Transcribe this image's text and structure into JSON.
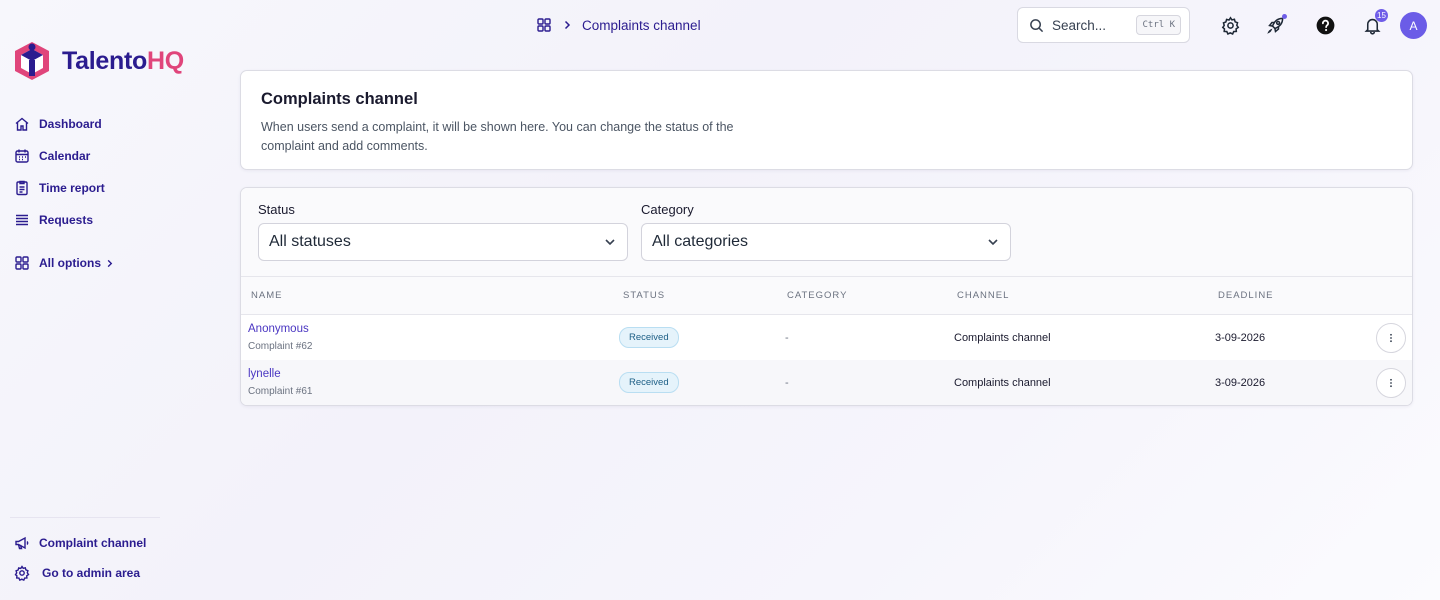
{
  "brand": {
    "name_part1": "Talento",
    "name_part2": "HQ"
  },
  "sidebar": {
    "items": [
      {
        "label": "Dashboard",
        "icon": "home-icon"
      },
      {
        "label": "Calendar",
        "icon": "calendar-icon"
      },
      {
        "label": "Time report",
        "icon": "clipboard-icon"
      },
      {
        "label": "Requests",
        "icon": "list-icon"
      },
      {
        "label": "All options",
        "icon": "grid-icon"
      }
    ],
    "bottom": [
      {
        "label": "Complaint channel",
        "icon": "megaphone-icon"
      },
      {
        "label": "Go to admin area",
        "icon": "gear-icon"
      }
    ]
  },
  "topbar": {
    "breadcrumb": "Complaints channel",
    "search_placeholder": "Search...",
    "search_shortcut": "Ctrl K",
    "notifications_count": "15",
    "avatar_initial": "A"
  },
  "header": {
    "title": "Complaints channel",
    "description": "When users send a complaint, it will be shown here. You can change the status of the complaint and add comments."
  },
  "filters": {
    "status_label": "Status",
    "status_value": "All statuses",
    "category_label": "Category",
    "category_value": "All categories"
  },
  "table": {
    "columns": [
      "Name",
      "Status",
      "Category",
      "Channel",
      "Deadline"
    ],
    "rows": [
      {
        "name": "Anonymous",
        "sub": "Complaint #62",
        "status": "Received",
        "category": "-",
        "channel": "Complaints channel",
        "deadline": "3-09-2026"
      },
      {
        "name": "lynelle",
        "sub": "Complaint #61",
        "status": "Received",
        "category": "-",
        "channel": "Complaints channel",
        "deadline": "3-09-2026"
      }
    ]
  },
  "colors": {
    "primary": "#2b1c8f",
    "accent": "#e0457b",
    "badge": "#6f5de8",
    "link": "#4a36c2"
  }
}
